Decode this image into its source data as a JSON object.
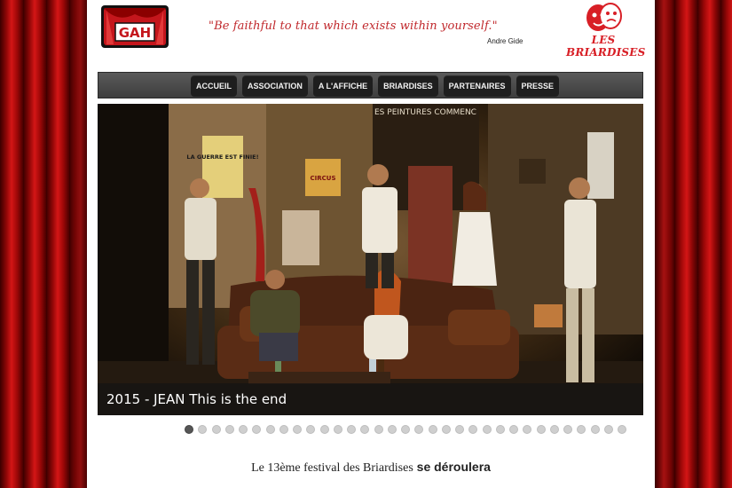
{
  "header": {
    "logo_left_text": "GAH",
    "quote": "\"Be faithful to that which exists within yourself.\"",
    "quote_author": "Andre Gide",
    "logo_right_text": "LES BRIARDISES"
  },
  "nav": {
    "items": [
      {
        "label": "ACCUEIL"
      },
      {
        "label": "ASSOCIATION"
      },
      {
        "label": "A L'AFFICHE"
      },
      {
        "label": "BRIARDISES"
      },
      {
        "label": "PARTENAIRES"
      },
      {
        "label": "PRESSE"
      }
    ]
  },
  "slider": {
    "caption": "2015 - JEAN This is the end",
    "poster_guerre": "LA GUERRE EST FINIE!",
    "wall_text": "ES PEINTURES COMMENC",
    "poster_circus": "CIRCUS",
    "slide_count": 33,
    "active_index": 0
  },
  "festival": {
    "part1": "Le 13ème festival des Briardises",
    "part2": "se déroulera"
  },
  "colors": {
    "accent_red": "#c0282c",
    "nav_bg": "#4a4a4a",
    "nav_item_bg": "#1e1e1e"
  }
}
